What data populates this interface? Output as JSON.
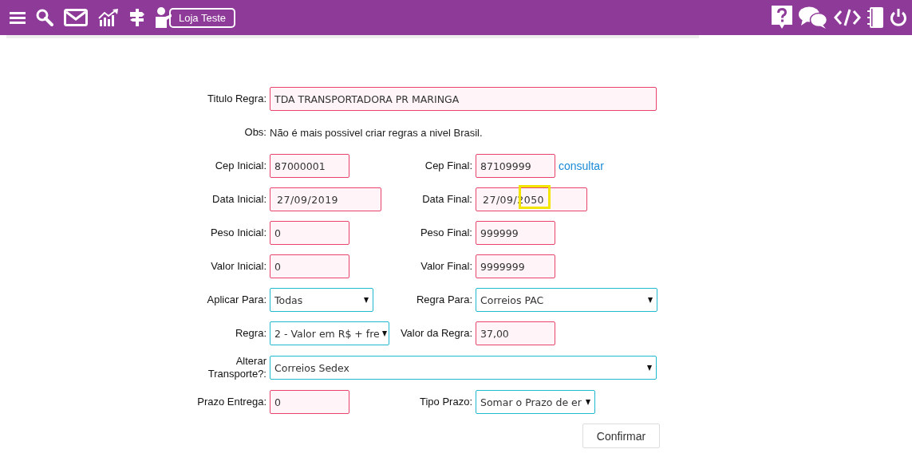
{
  "toolbar": {
    "store_button": "Loja Teste"
  },
  "form": {
    "title_field": {
      "label": "Titulo Regra:",
      "value": "TDA TRANSPORTADORA PR MARINGA"
    },
    "obs": {
      "label": "Obs:",
      "text": "Não é mais possivel criar regras a nivel Brasil."
    },
    "rows": [
      {
        "left": {
          "label": "Cep Inicial:",
          "kind": "text",
          "value": "87000001"
        },
        "right": {
          "label": "Cep Final:",
          "kind": "text",
          "value": "87109999",
          "link": "consultar"
        }
      },
      {
        "left": {
          "label": "Data Inicial:",
          "kind": "date",
          "value": "27/09/2019"
        },
        "right": {
          "label": "Data Final:",
          "kind": "date",
          "value": "27/09/2050",
          "highlighted": true
        }
      },
      {
        "left": {
          "label": "Peso Inicial:",
          "kind": "text",
          "value": "0"
        },
        "right": {
          "label": "Peso Final:",
          "kind": "text",
          "value": "999999"
        }
      },
      {
        "left": {
          "label": "Valor Inicial:",
          "kind": "text",
          "value": "0"
        },
        "right": {
          "label": "Valor Final:",
          "kind": "text",
          "value": "9999999"
        }
      },
      {
        "left": {
          "label": "Aplicar Para:",
          "kind": "select",
          "value": "Todas"
        },
        "right": {
          "label": "Regra Para:",
          "kind": "select",
          "value": "Correios PAC"
        }
      },
      {
        "left": {
          "label": "Regra:",
          "kind": "select",
          "value": "2 - Valor em R$ + fre"
        },
        "right": {
          "label": "Valor da Regra:",
          "kind": "text",
          "value": "37,00"
        }
      },
      {
        "full": {
          "label": "Alterar Transporte?:",
          "kind": "select",
          "value": "Correios Sedex"
        }
      },
      {
        "left": {
          "label": "Prazo Entrega:",
          "kind": "text",
          "value": "0"
        },
        "right": {
          "label": "Tipo Prazo:",
          "kind": "select",
          "value": "Somar o Prazo de er"
        }
      }
    ],
    "submit": "Confirmar"
  }
}
